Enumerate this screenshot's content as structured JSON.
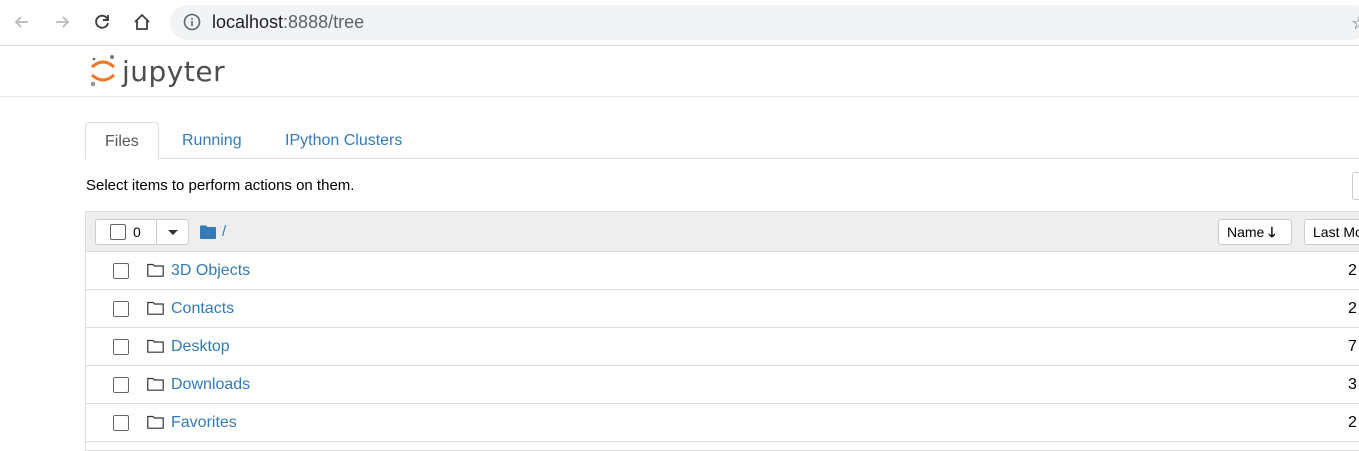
{
  "browser": {
    "url_host": "localhost",
    "url_path": ":8888/tree"
  },
  "header": {
    "logo_text": "jupyter"
  },
  "tabs": [
    {
      "label": "Files"
    },
    {
      "label": "Running"
    },
    {
      "label": "IPython Clusters"
    }
  ],
  "hint": "Select items to perform actions on them.",
  "list": {
    "selected_count": "0",
    "breadcrumb": "/",
    "sort_name_label": "Name",
    "sort_modified_label": "Last Mo",
    "rows": [
      {
        "name": "3D Objects",
        "modified": "2"
      },
      {
        "name": "Contacts",
        "modified": "2"
      },
      {
        "name": "Desktop",
        "modified": "7"
      },
      {
        "name": "Downloads",
        "modified": "3"
      },
      {
        "name": "Favorites",
        "modified": "2"
      }
    ]
  },
  "colors": {
    "link": "#337ab7",
    "logo_orange": "#f37726",
    "header_bg": "#eeeeee"
  }
}
